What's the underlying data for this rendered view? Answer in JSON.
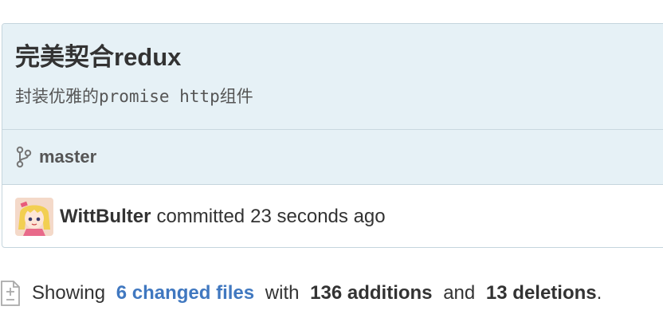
{
  "commit": {
    "title": "完美契合redux",
    "description": "封装优雅的promise http组件",
    "branch": {
      "icon": "git-branch-icon",
      "name": "master"
    },
    "author": {
      "avatar": "user-avatar",
      "name": "WittBulter",
      "action": "committed",
      "time": "23 seconds ago"
    }
  },
  "diff_summary": {
    "icon": "file-diff-icon",
    "prefix": "Showing",
    "changed_files": "6 changed files",
    "with": "with",
    "additions": "136 additions",
    "and": "and",
    "deletions": "13 deletions",
    "period": "."
  },
  "colors": {
    "header_bg": "#e6f1f6",
    "border": "#c5d5dd",
    "link": "#4078c0",
    "text": "#333333"
  }
}
